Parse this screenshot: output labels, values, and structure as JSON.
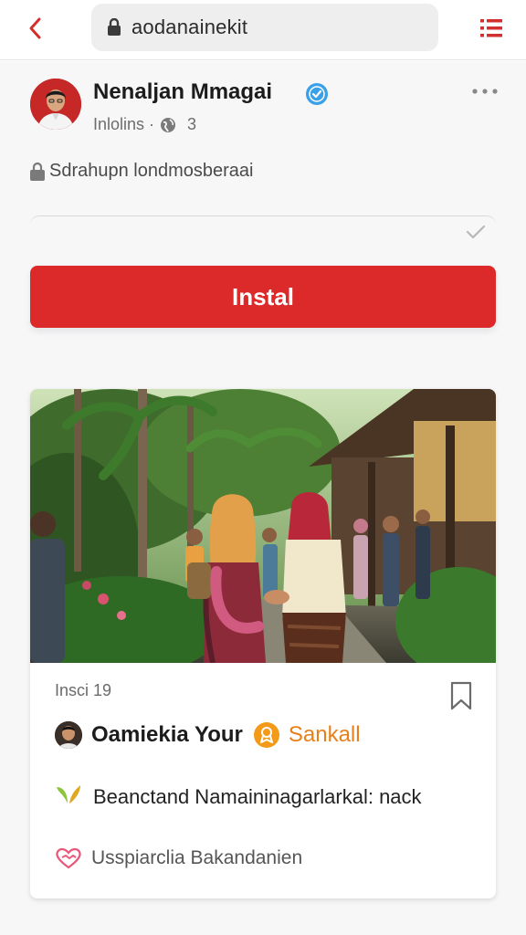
{
  "header": {
    "url": "aodanainekit",
    "back_icon": "chevron-left-icon",
    "lock_icon": "lock-icon",
    "menu_icon": "hamburger-menu-icon",
    "accent": "#dc2a2a"
  },
  "profile": {
    "name": "Nenaljan Mmagai",
    "meta_text": "Inlolins ·",
    "meta_count": "3",
    "verified_icon": "verified-badge-icon",
    "verified_color": "#3aa0e8",
    "more_icon": "more-dots-icon"
  },
  "notice": {
    "text": "Sdrahupn londmosberaai",
    "icon": "lock-icon"
  },
  "install": {
    "label": "Instal",
    "color": "#dc2a2a"
  },
  "card": {
    "date": "Insci 19",
    "author": "Oamiekia Your",
    "tag": "Sankall",
    "tag_color": "#e8801a",
    "line1": "Beanctand Namaininagarlarkal: nack",
    "line1_icon": "leaf-icon",
    "line2": "Usspiarclia Bakandanien",
    "line2_icon": "heart-handshake-icon",
    "bookmark_icon": "bookmark-icon"
  }
}
